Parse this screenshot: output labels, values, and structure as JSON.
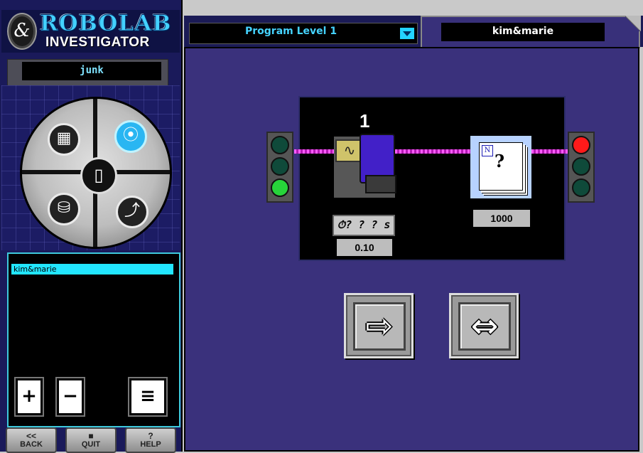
{
  "logo": {
    "top": "ROBOLAB",
    "bottom": "INVESTIGATOR",
    "mark": "&"
  },
  "project": {
    "name": "junk"
  },
  "wheel": {
    "buttons": [
      {
        "icon": "calculator-icon",
        "glyph": "▦"
      },
      {
        "icon": "traffic-light-icon",
        "glyph": "⦿"
      },
      {
        "icon": "beakers-icon",
        "glyph": "⛁"
      },
      {
        "icon": "upload-arrow-icon",
        "glyph": "⤴"
      },
      {
        "icon": "page-icon",
        "glyph": "▯"
      }
    ]
  },
  "list": {
    "items": [
      "kim&marie"
    ],
    "add_glyph": "+",
    "remove_glyph": "−",
    "pages_glyph": "≡"
  },
  "nav": {
    "back": {
      "glyph": "<<",
      "label": "BACK"
    },
    "quit": {
      "glyph": "■",
      "label": "QUIT"
    },
    "help": {
      "glyph": "?",
      "label": "HELP"
    }
  },
  "header": {
    "level": "Program Level 1",
    "tab_name": "kim&marie"
  },
  "program": {
    "port_number": "1",
    "sensor_glyph": "∿",
    "timer_label": "? ? ? s",
    "timer_icon": "⏱",
    "timer_value": "0.10",
    "doc_badge": "N",
    "doc_glyph": "?",
    "doc_value": "1000",
    "start_light": [
      "off",
      "off",
      "green"
    ],
    "end_light": [
      "red",
      "off",
      "off"
    ]
  },
  "buttons": {
    "right_arrow": "⇨",
    "both_arrow": "⇔"
  },
  "colors": {
    "accent": "#22e6ff",
    "panel": "#1a1a5a",
    "canvas": "#3a317c",
    "wire": "#ff5bff"
  }
}
